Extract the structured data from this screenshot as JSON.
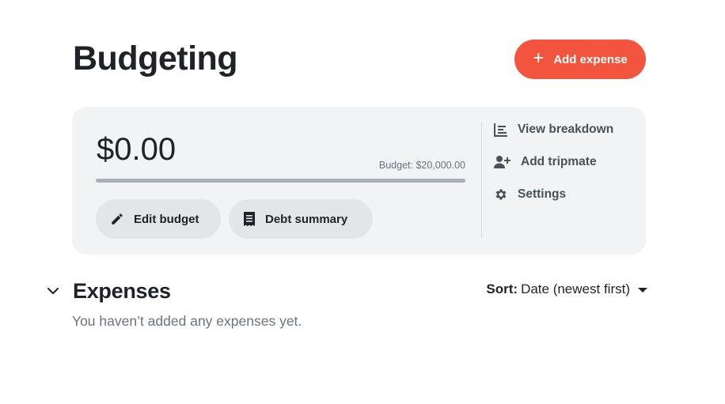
{
  "header": {
    "title": "Budgeting",
    "add_button_label": "Add expense",
    "add_button_icon": "plus-icon"
  },
  "budget_card": {
    "amount": "$0.00",
    "budget_label": "Budget: $20,000.00",
    "progress_fraction": 0,
    "edit_button": {
      "label": "Edit budget",
      "icon": "pencil-icon"
    },
    "debt_button": {
      "label": "Debt summary",
      "icon": "receipt-icon"
    },
    "side_links": [
      {
        "label": "View breakdown",
        "icon": "bar-chart-icon"
      },
      {
        "label": "Add tripmate",
        "icon": "user-plus-icon"
      },
      {
        "label": "Settings",
        "icon": "gear-icon"
      }
    ]
  },
  "expenses": {
    "title": "Expenses",
    "sort_key": "Sort:",
    "sort_value": "Date (newest first)",
    "empty_message": "You haven’t added any expenses yet."
  },
  "colors": {
    "accent": "#f2543d",
    "card_bg": "#f1f3f5",
    "pill_bg": "#e3e6e9",
    "progress_track": "#a9b1ba"
  }
}
